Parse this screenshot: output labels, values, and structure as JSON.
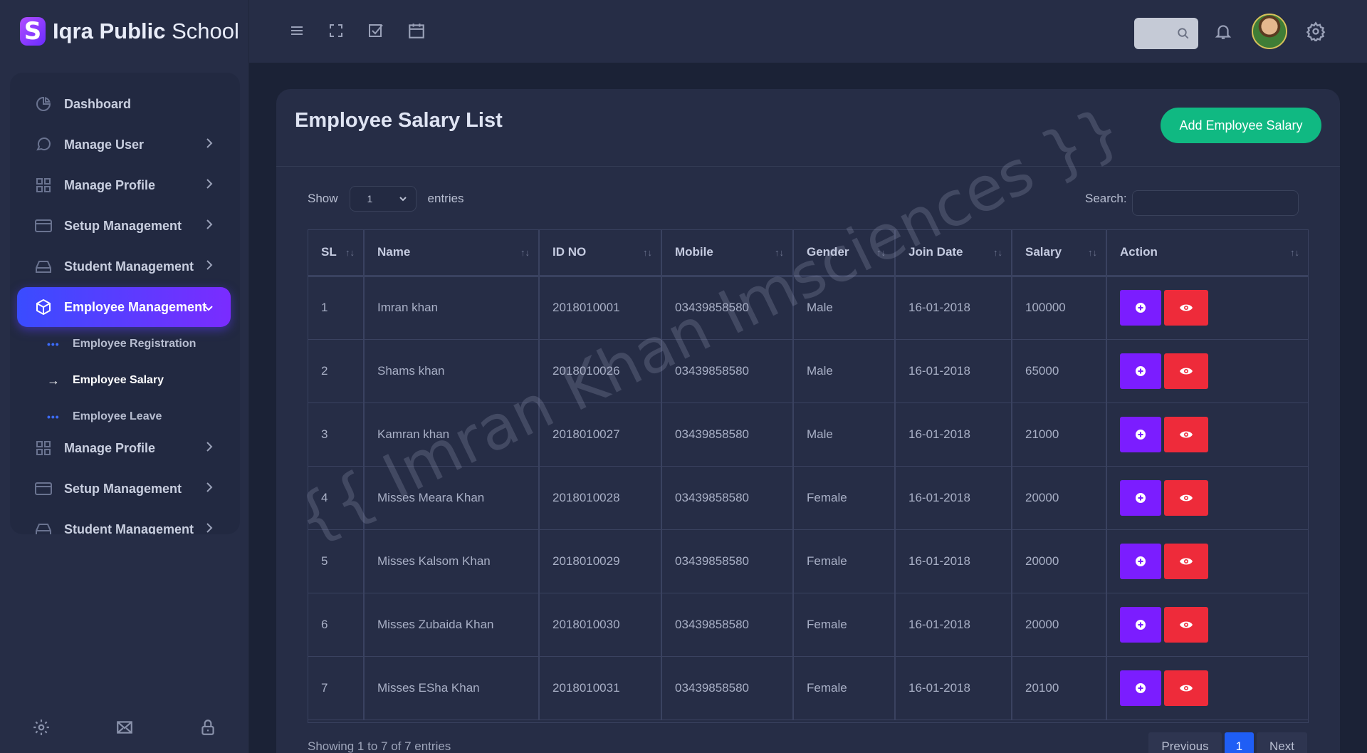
{
  "brand": {
    "name_bold": "Iqra Public",
    "name_rest": "School",
    "logo_letter": "S"
  },
  "sidebar": {
    "items": [
      {
        "label": "Dashboard",
        "icon": "pie-chart-icon"
      },
      {
        "label": "Manage User",
        "icon": "chat-bubble-icon"
      },
      {
        "label": "Manage Profile",
        "icon": "grid-icon"
      },
      {
        "label": "Setup Management",
        "icon": "card-icon"
      },
      {
        "label": "Student Management",
        "icon": "drive-icon"
      },
      {
        "label": "Employee Management",
        "icon": "cube-icon"
      },
      {
        "label": "Manage Profile",
        "icon": "grid-icon"
      },
      {
        "label": "Setup Management",
        "icon": "card-icon"
      },
      {
        "label": "Student Management",
        "icon": "drive-icon"
      }
    ],
    "sub_items": [
      {
        "label": "Employee Registration",
        "marker": "•••"
      },
      {
        "label": "Employee Salary",
        "marker": "→"
      },
      {
        "label": "Employee Leave",
        "marker": "•••"
      }
    ],
    "footer_icons": [
      "settings-icon",
      "mail-icon",
      "lock-icon"
    ]
  },
  "topbar": {
    "icons": [
      "menu-icon",
      "fullscreen-icon",
      "checkbox-icon",
      "calendar-icon",
      "search-icon",
      "bell-icon",
      "gear-icon"
    ]
  },
  "page": {
    "title": "Employee Salary List",
    "add_button": "Add Employee Salary",
    "show_label": "Show",
    "show_value": "1",
    "entries_label": "entries",
    "search_label": "Search:",
    "info": "Showing 1 to 7 of 7 entries",
    "pager": {
      "previous": "Previous",
      "current": "1",
      "next": "Next"
    }
  },
  "table": {
    "headers": [
      "SL",
      "Name",
      "ID NO",
      "Mobile",
      "Gender",
      "Join Date",
      "Salary",
      "Action"
    ],
    "rows": [
      [
        "1",
        "Imran khan",
        "2018010001",
        "03439858580",
        "Male",
        "16-01-2018",
        "100000"
      ],
      [
        "2",
        "Shams khan",
        "2018010026",
        "03439858580",
        "Male",
        "16-01-2018",
        "65000"
      ],
      [
        "3",
        "Kamran khan",
        "2018010027",
        "03439858580",
        "Male",
        "16-01-2018",
        "21000"
      ],
      [
        "4",
        "Misses Meara Khan",
        "2018010028",
        "03439858580",
        "Female",
        "16-01-2018",
        "20000"
      ],
      [
        "5",
        "Misses Kalsom Khan",
        "2018010029",
        "03439858580",
        "Female",
        "16-01-2018",
        "20000"
      ],
      [
        "6",
        "Misses Zubaida Khan",
        "2018010030",
        "03439858580",
        "Female",
        "16-01-2018",
        "20000"
      ],
      [
        "7",
        "Misses ESha Khan",
        "2018010031",
        "03439858580",
        "Female",
        "16-01-2018",
        "20100"
      ]
    ]
  },
  "watermark": "{{ Imran Khan Imsciences }}",
  "colors": {
    "accent_green": "#10b982",
    "action_purple": "#7b1dff",
    "action_red": "#ee2b3a",
    "active_gradient_start": "#3a4cff",
    "active_gradient_end": "#7a2cff",
    "pager_active": "#1f5ef5"
  }
}
